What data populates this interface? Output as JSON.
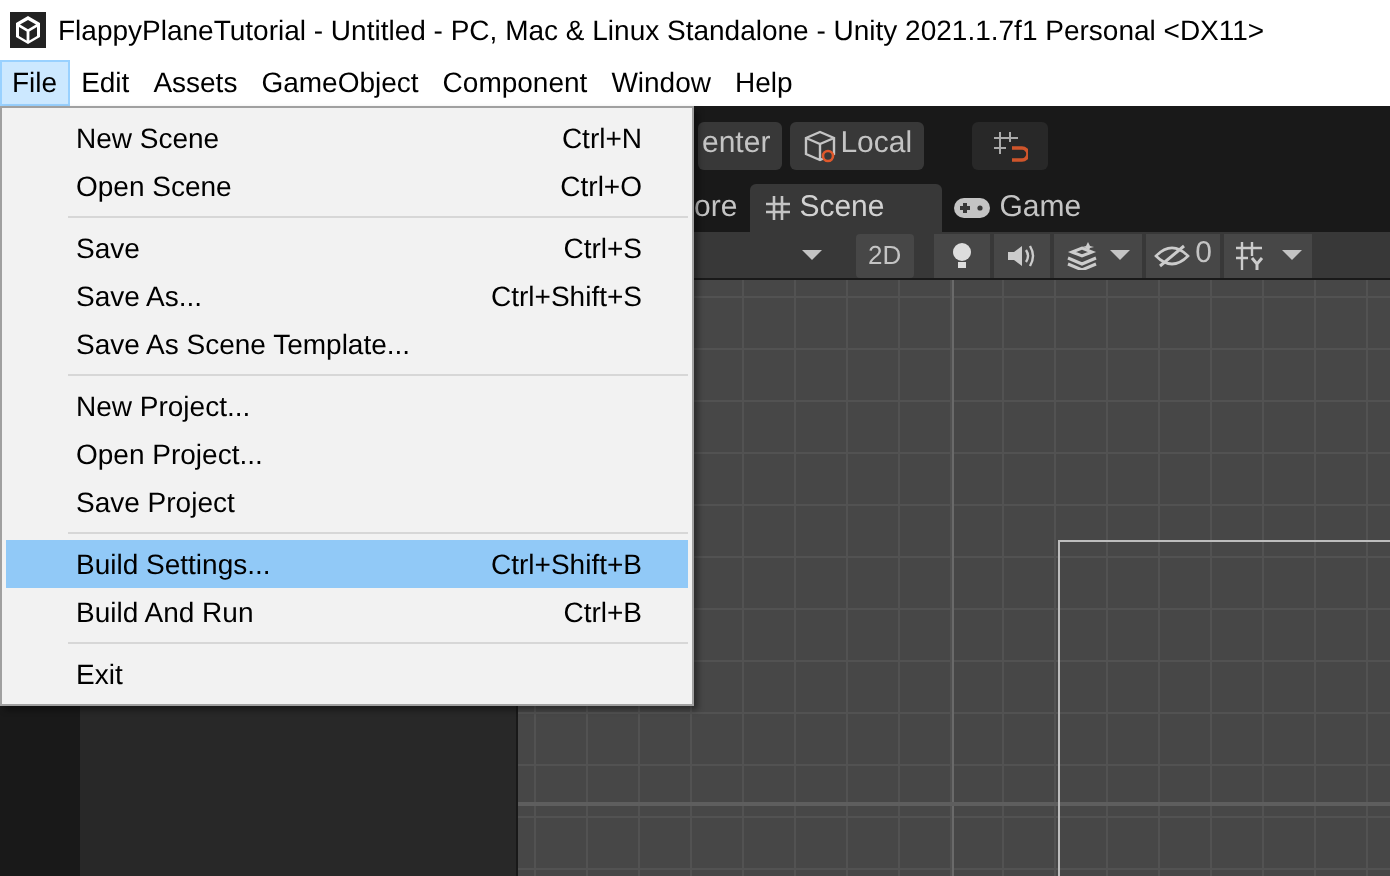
{
  "window": {
    "title": "FlappyPlaneTutorial - Untitled - PC, Mac & Linux Standalone - Unity 2021.1.7f1 Personal <DX11>"
  },
  "menu_bar": [
    {
      "label": "File",
      "selected": true
    },
    {
      "label": "Edit",
      "selected": false
    },
    {
      "label": "Assets",
      "selected": false
    },
    {
      "label": "GameObject",
      "selected": false
    },
    {
      "label": "Component",
      "selected": false
    },
    {
      "label": "Window",
      "selected": false
    },
    {
      "label": "Help",
      "selected": false
    }
  ],
  "file_menu": [
    {
      "kind": "item",
      "label": "New Scene",
      "shortcut": "Ctrl+N",
      "selected": false
    },
    {
      "kind": "item",
      "label": "Open Scene",
      "shortcut": "Ctrl+O",
      "selected": false
    },
    {
      "kind": "separator"
    },
    {
      "kind": "item",
      "label": "Save",
      "shortcut": "Ctrl+S",
      "selected": false
    },
    {
      "kind": "item",
      "label": "Save As...",
      "shortcut": "Ctrl+Shift+S",
      "selected": false
    },
    {
      "kind": "item",
      "label": "Save As Scene Template...",
      "selected": false
    },
    {
      "kind": "separator"
    },
    {
      "kind": "item",
      "label": "New Project...",
      "selected": false
    },
    {
      "kind": "item",
      "label": "Open Project...",
      "selected": false
    },
    {
      "kind": "item",
      "label": "Save Project",
      "selected": false
    },
    {
      "kind": "separator"
    },
    {
      "kind": "item",
      "label": "Build Settings...",
      "shortcut": "Ctrl+Shift+B",
      "selected": true
    },
    {
      "kind": "item",
      "label": "Build And Run",
      "shortcut": "Ctrl+B",
      "selected": false
    },
    {
      "kind": "separator"
    },
    {
      "kind": "item",
      "label": "Exit",
      "selected": false
    }
  ],
  "toolbar": {
    "pivot_button": "enter",
    "space_button": "Local"
  },
  "tabs": [
    {
      "label": "ore",
      "kind": "plain",
      "selected": false
    },
    {
      "label": "Scene",
      "kind": "scene",
      "selected": true
    },
    {
      "label": "Game",
      "kind": "game",
      "selected": false
    }
  ],
  "scene_toolbar": {
    "mode_button": "2D",
    "hidden_count": "0"
  }
}
